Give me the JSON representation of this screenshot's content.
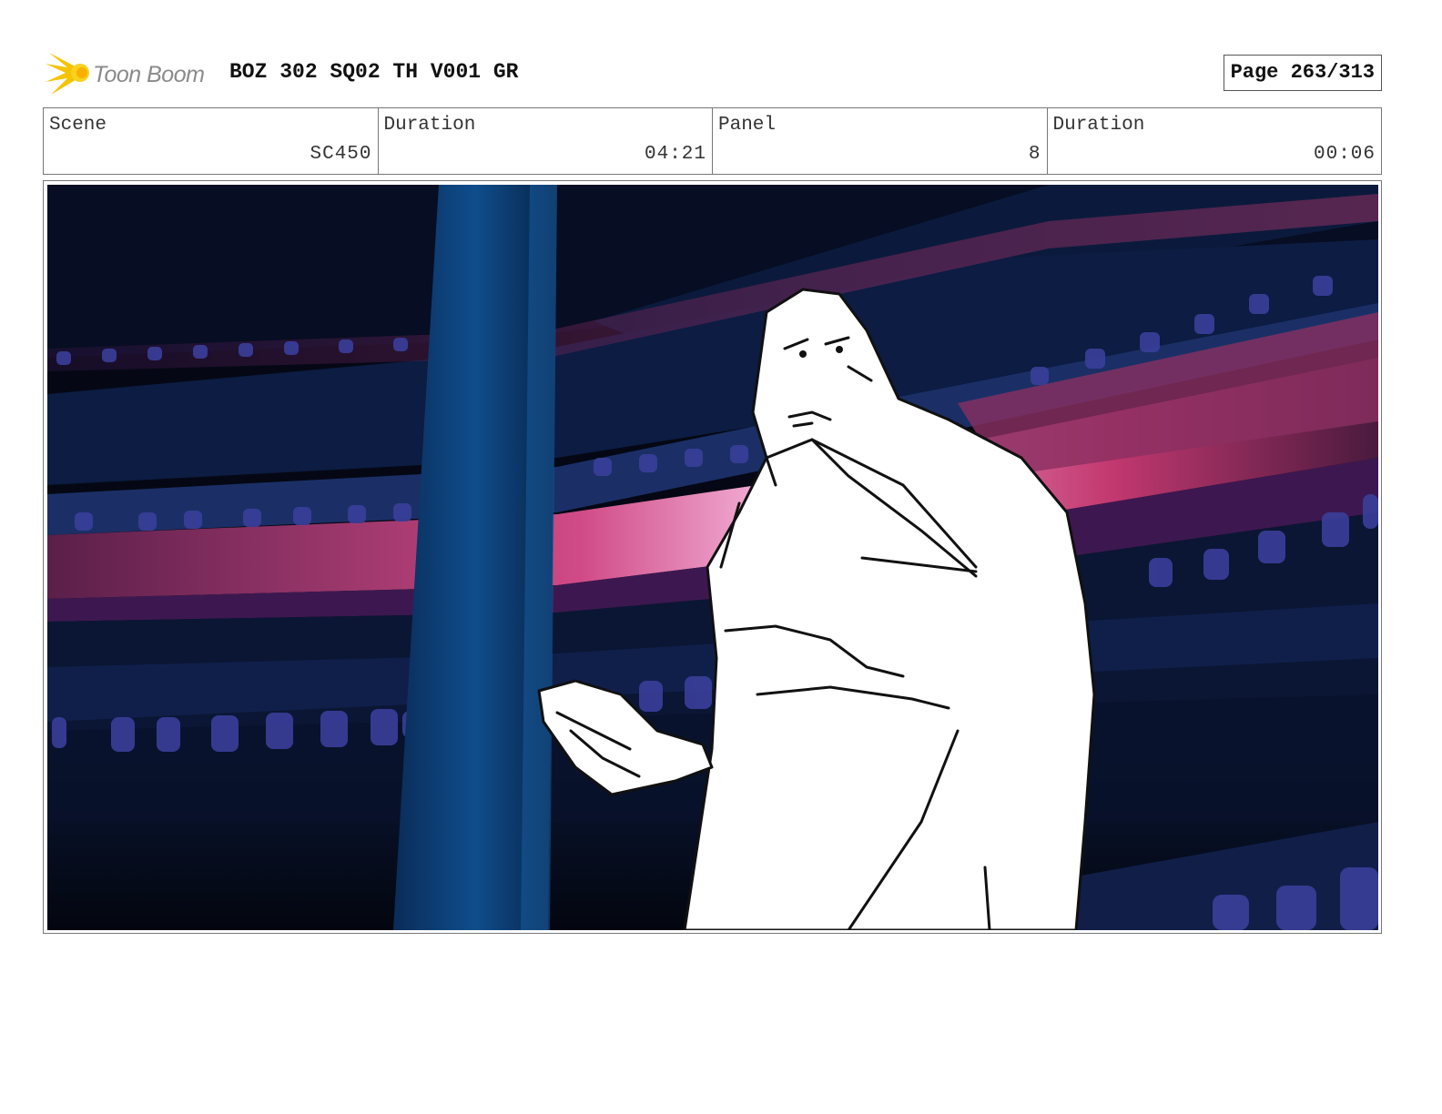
{
  "header": {
    "logo_text": "Toon Boom",
    "doc_title": "BOZ 302 SQ02 TH V001 GR",
    "page": "Page 263/313"
  },
  "info": {
    "scene_label": "Scene",
    "scene_value": "SC450",
    "scene_duration_label": "Duration",
    "scene_duration_value": "04:21",
    "panel_label": "Panel",
    "panel_value": "8",
    "panel_duration_label": "Duration",
    "panel_duration_value": "00:06"
  },
  "colors": {
    "logo_yellow": "#f5c400",
    "bg_dark": "#050814",
    "ring_pink": "#c2386f",
    "pillar_blue": "#0b3f78",
    "jar_blue": "#3a3f9a"
  }
}
